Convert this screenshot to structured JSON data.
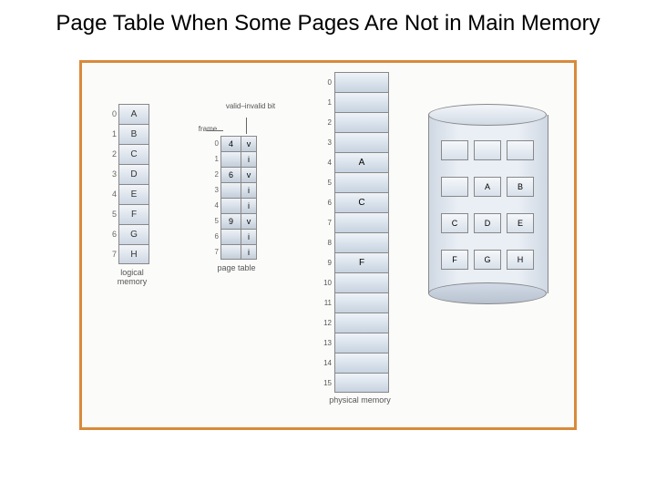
{
  "title": "Page Table When Some Pages Are Not in Main Memory",
  "logical_memory": {
    "caption": "logical memory",
    "rows": [
      {
        "idx": "0",
        "val": "A"
      },
      {
        "idx": "1",
        "val": "B"
      },
      {
        "idx": "2",
        "val": "C"
      },
      {
        "idx": "3",
        "val": "D"
      },
      {
        "idx": "4",
        "val": "E"
      },
      {
        "idx": "5",
        "val": "F"
      },
      {
        "idx": "6",
        "val": "G"
      },
      {
        "idx": "7",
        "val": "H"
      }
    ]
  },
  "page_table": {
    "caption": "page table",
    "frame_label": "frame",
    "valid_invalid_label": "valid–invalid bit",
    "rows": [
      {
        "idx": "0",
        "frame": "4",
        "bit": "v"
      },
      {
        "idx": "1",
        "frame": "",
        "bit": "i"
      },
      {
        "idx": "2",
        "frame": "6",
        "bit": "v"
      },
      {
        "idx": "3",
        "frame": "",
        "bit": "i"
      },
      {
        "idx": "4",
        "frame": "",
        "bit": "i"
      },
      {
        "idx": "5",
        "frame": "9",
        "bit": "v"
      },
      {
        "idx": "6",
        "frame": "",
        "bit": "i"
      },
      {
        "idx": "7",
        "frame": "",
        "bit": "i"
      }
    ]
  },
  "physical_memory": {
    "caption": "physical memory",
    "rows": [
      {
        "idx": "0",
        "val": ""
      },
      {
        "idx": "1",
        "val": ""
      },
      {
        "idx": "2",
        "val": ""
      },
      {
        "idx": "3",
        "val": ""
      },
      {
        "idx": "4",
        "val": "A"
      },
      {
        "idx": "5",
        "val": ""
      },
      {
        "idx": "6",
        "val": "C"
      },
      {
        "idx": "7",
        "val": ""
      },
      {
        "idx": "8",
        "val": ""
      },
      {
        "idx": "9",
        "val": "F"
      },
      {
        "idx": "10",
        "val": ""
      },
      {
        "idx": "11",
        "val": ""
      },
      {
        "idx": "12",
        "val": ""
      },
      {
        "idx": "13",
        "val": ""
      },
      {
        "idx": "14",
        "val": ""
      },
      {
        "idx": "15",
        "val": ""
      }
    ]
  },
  "disk": {
    "blocks": [
      "",
      "",
      "",
      "",
      "A",
      "B",
      "C",
      "D",
      "E",
      "F",
      "G",
      "H"
    ]
  }
}
